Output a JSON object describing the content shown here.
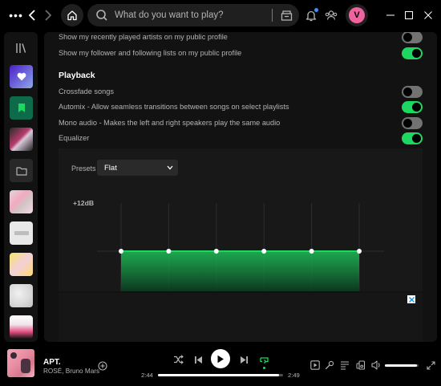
{
  "search": {
    "placeholder": "What do you want to play?"
  },
  "user": {
    "initial": "V"
  },
  "settings": {
    "rows_top": [
      {
        "label": "Show my recently played artists on my public profile",
        "on": false
      },
      {
        "label": "Show my follower and following lists on my public profile",
        "on": true
      }
    ],
    "playback_title": "Playback",
    "rows_playback": [
      {
        "label": "Crossfade songs",
        "on": false
      },
      {
        "label": "Automix - Allow seamless transitions between songs on select playlists",
        "on": true
      },
      {
        "label": "Mono audio - Makes the left and right speakers play the same audio",
        "on": false
      },
      {
        "label": "Equalizer",
        "on": true
      }
    ]
  },
  "equalizer": {
    "presets_label": "Presets",
    "preset_value": "Flat",
    "max_label": "+12dB",
    "bands_db": [
      0,
      0,
      0,
      0,
      0,
      0
    ]
  },
  "now_playing": {
    "title": "APT.",
    "artist": "ROSÉ, Bruno Mars",
    "elapsed": "2:44",
    "total": "2:49",
    "progress_fraction": 0.97
  },
  "volume": {
    "level_fraction": 0.95
  },
  "colors": {
    "accent": "#1ed760",
    "avatar": "#f0649e",
    "panel": "#121212"
  }
}
